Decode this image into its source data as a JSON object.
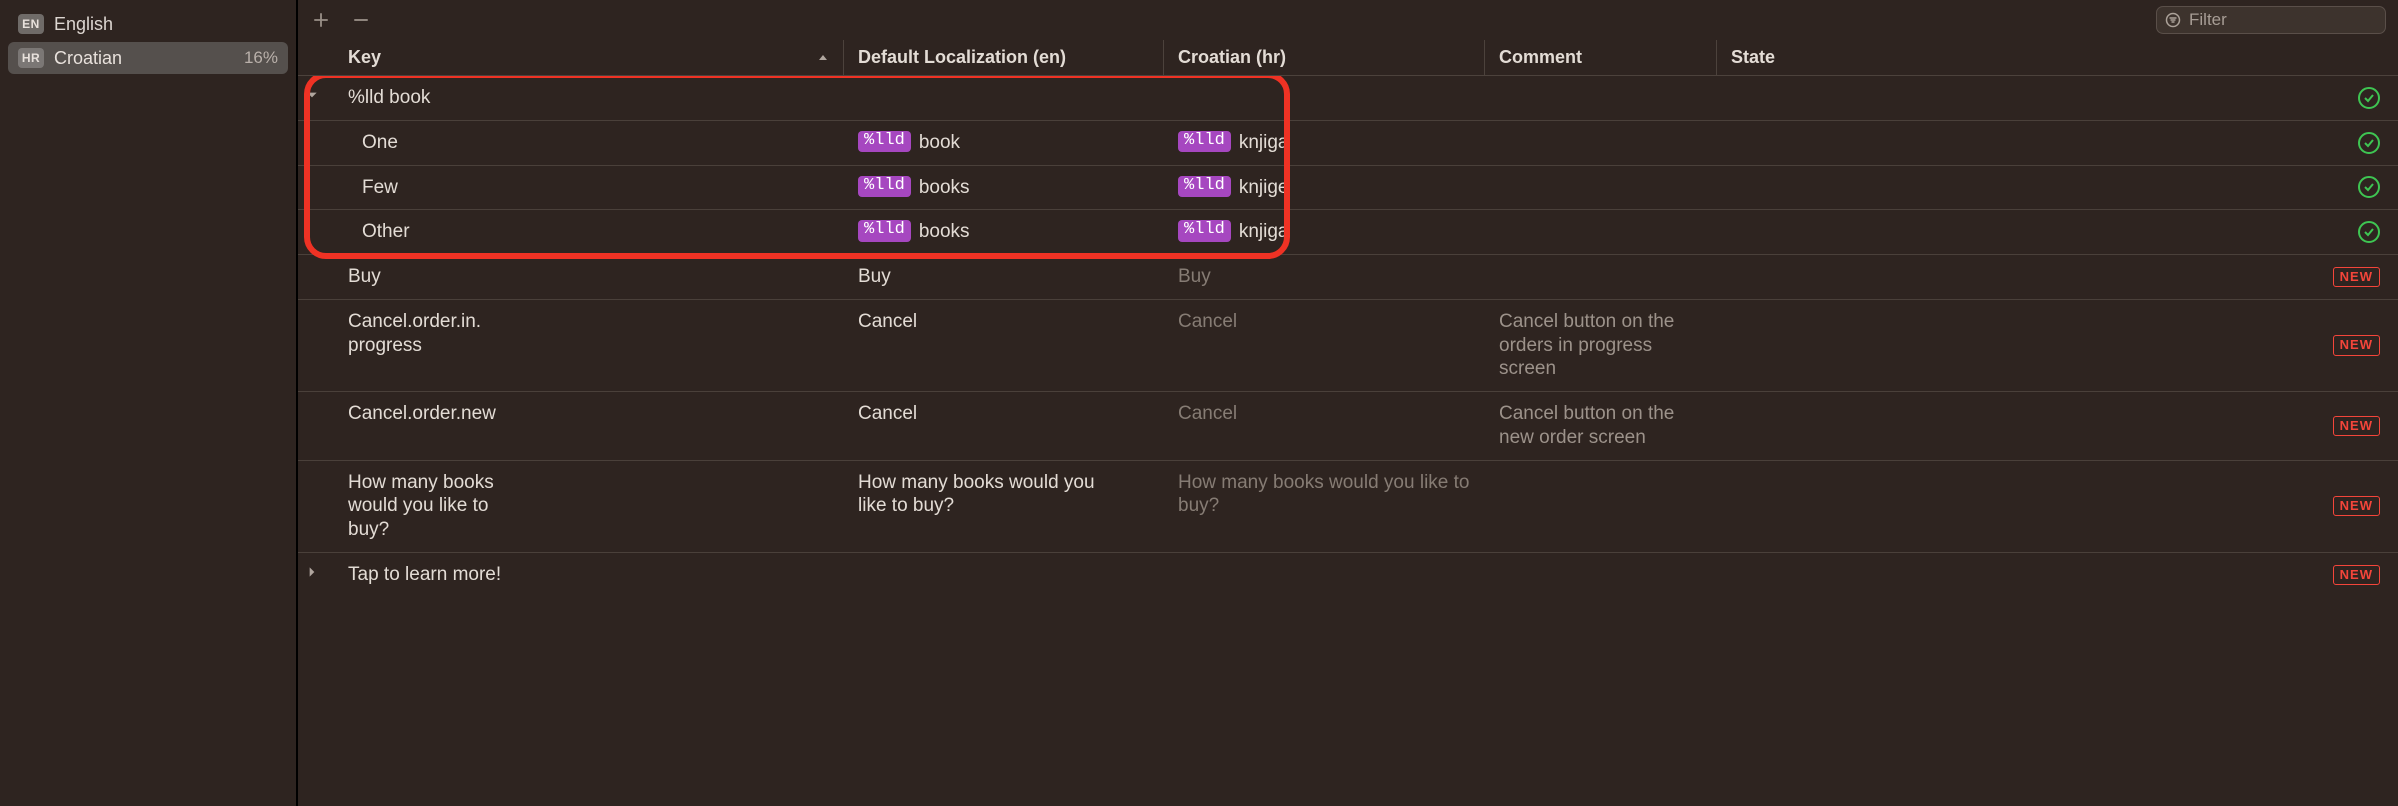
{
  "sidebar": {
    "items": [
      {
        "badge": "EN",
        "name": "English",
        "pct": "",
        "selected": false
      },
      {
        "badge": "HR",
        "name": "Croatian",
        "pct": "16%",
        "selected": true
      }
    ]
  },
  "toolbar": {
    "filter_placeholder": "Filter"
  },
  "columns": {
    "key": "Key",
    "default": "Default Localization (en)",
    "target": "Croatian (hr)",
    "comment": "Comment",
    "state": "State"
  },
  "token": "%lld",
  "rows": {
    "group_key": "%lld book",
    "one": {
      "key": "One",
      "en_suffix": "book",
      "hr_suffix": "knjiga"
    },
    "few": {
      "key": "Few",
      "en_suffix": "books",
      "hr_suffix": "knjige"
    },
    "other": {
      "key": "Other",
      "en_suffix": "books",
      "hr_suffix": "knjiga"
    },
    "r1": {
      "key": "Buy",
      "en": "Buy",
      "hr": "Buy",
      "hr_muted": true,
      "comment": "",
      "state": "new"
    },
    "r2": {
      "key": "Cancel.order.in.progress",
      "en": "Cancel",
      "hr": "Cancel",
      "hr_muted": true,
      "comment": "Cancel button on the orders in progress screen",
      "state": "new"
    },
    "r3": {
      "key": "Cancel.order.new",
      "en": "Cancel",
      "hr": "Cancel",
      "hr_muted": true,
      "comment": "Cancel button on the new order screen",
      "state": "new"
    },
    "r4": {
      "key": "How many books would you like to buy?",
      "en": "How many books would you like to buy?",
      "hr": "How many books would you like to buy?",
      "hr_muted": true,
      "comment": "",
      "state": "new"
    },
    "r5": {
      "key": "Tap to learn more!",
      "en": "",
      "hr": "",
      "comment": "",
      "state": "new"
    }
  },
  "badges": {
    "new": "NEW"
  }
}
